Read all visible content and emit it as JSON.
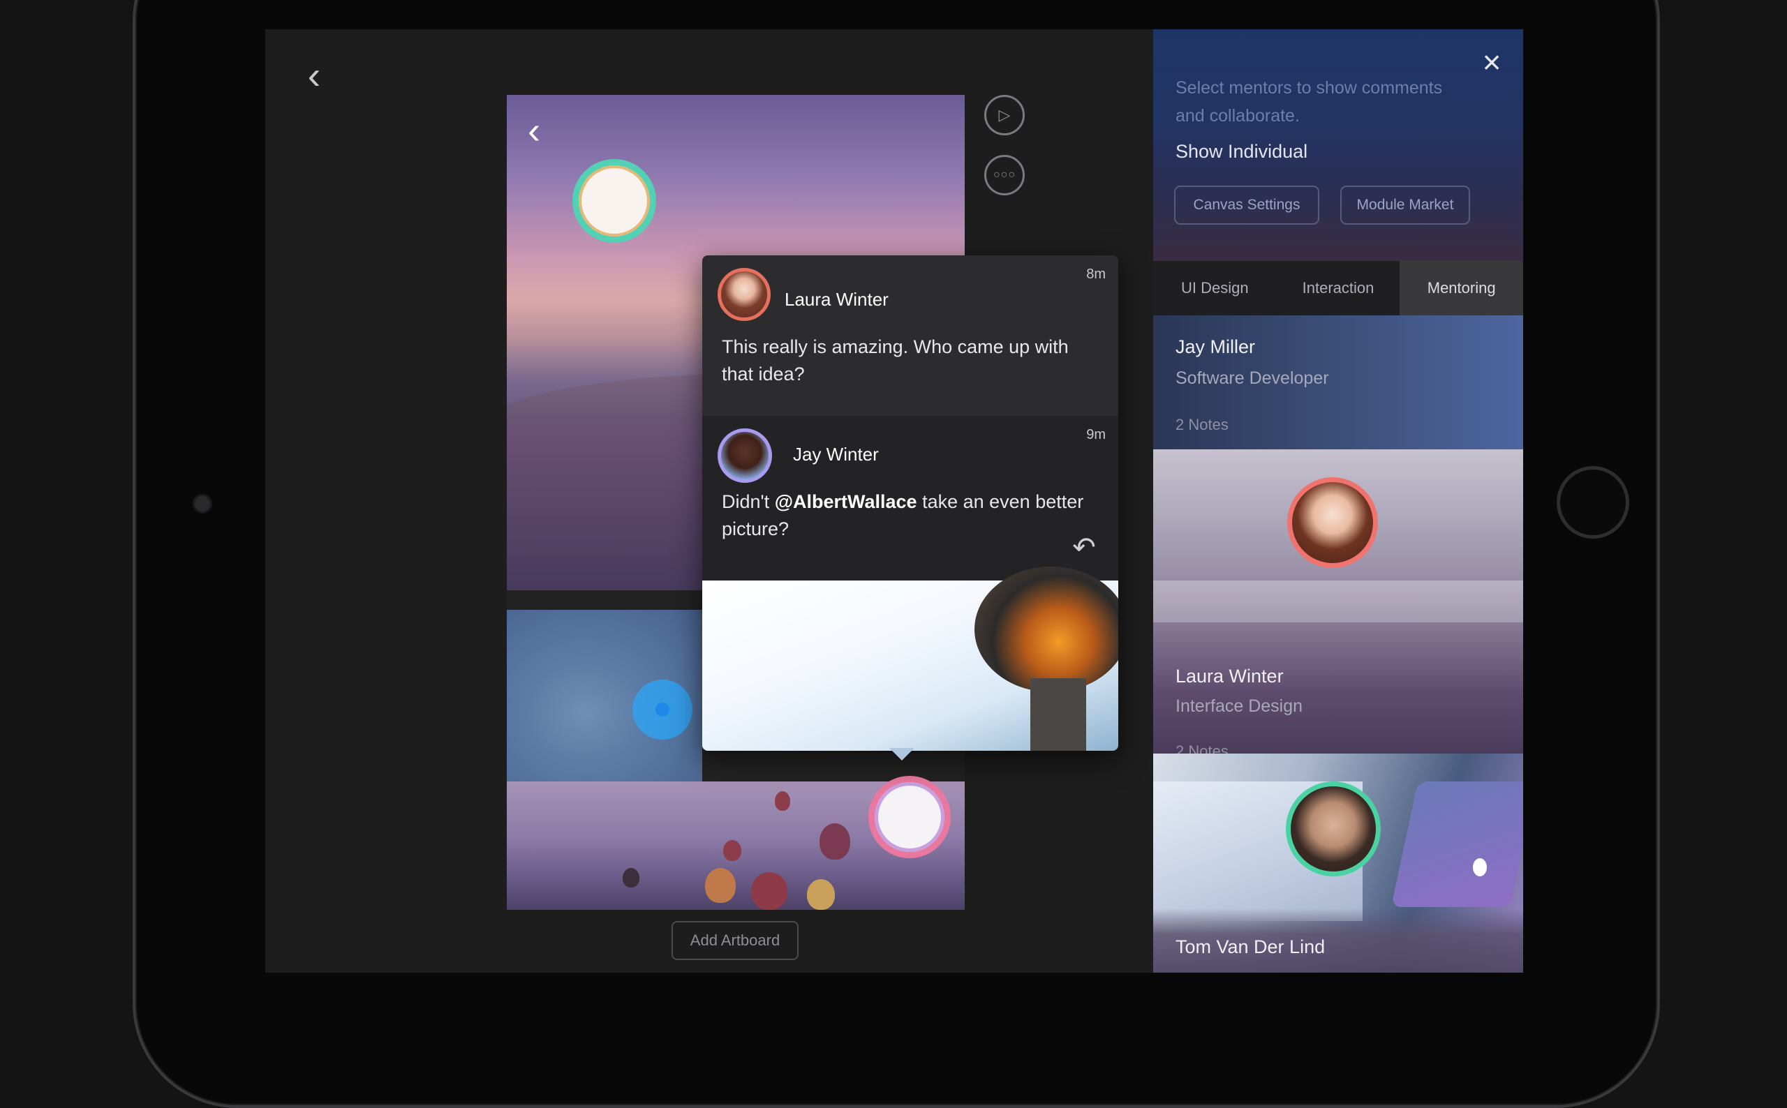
{
  "canvas": {
    "add_artboard_label": "Add Artboard"
  },
  "comments": [
    {
      "author": "Laura Winter",
      "time": "8m",
      "text": "This really is amazing. Who came up with that idea?"
    },
    {
      "author": "Jay Winter",
      "time": "9m",
      "text_before": "Didn't ",
      "mention": "@AlbertWallace",
      "text_after": " take an even better picture?"
    }
  ],
  "panel": {
    "description": "Select mentors to show comments and collaborate.",
    "title": "Show Individual",
    "buttons": {
      "canvas_settings": "Canvas Settings",
      "module_market": "Module Market"
    },
    "tabs": [
      "UI Design",
      "Interaction",
      "Mentoring"
    ],
    "active_tab": "Mentoring",
    "mentors": [
      {
        "name": "Jay Miller",
        "role": "Software Developer",
        "notes": "2 Notes"
      },
      {
        "name": "Laura Winter",
        "role": "Interface Design",
        "notes": "2 Notes"
      },
      {
        "name": "Tom Van Der Lind"
      }
    ]
  },
  "icons": {
    "back": "chevron-left-icon",
    "close": "close-icon",
    "play": "play-icon",
    "more": "more-icon",
    "reply": "reply-icon"
  },
  "colors": {
    "pin_green": "#53d1b4",
    "pin_pink": "#e878a0",
    "avatar_ring_laura": "#f0736d",
    "avatar_ring_tom": "#4bd2a2",
    "active_tab_bg": "#39393c"
  }
}
